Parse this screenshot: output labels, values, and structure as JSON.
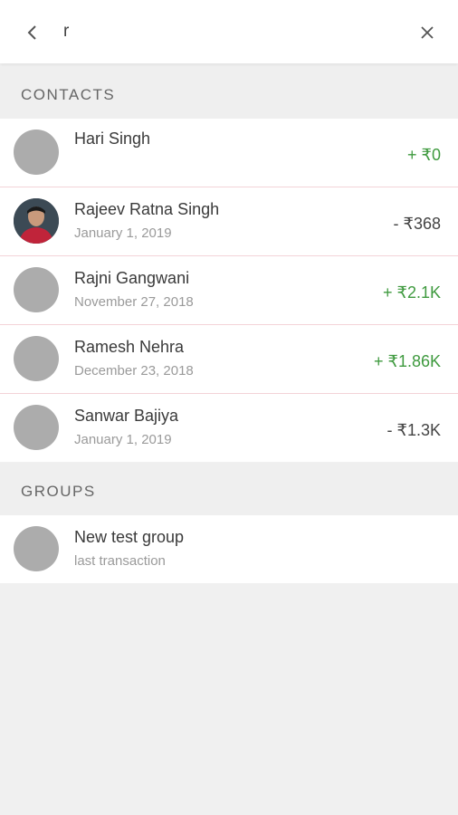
{
  "search": {
    "value": "r"
  },
  "sections": {
    "contacts_title": "CONTACTS",
    "groups_title": "GROUPS"
  },
  "contacts": [
    {
      "name": "Hari Singh",
      "date": "",
      "amount": "+ ₹0",
      "sign": "positive",
      "has_photo": false
    },
    {
      "name": "Rajeev Ratna Singh",
      "date": "January 1, 2019",
      "amount": "- ₹368",
      "sign": "negative",
      "has_photo": true
    },
    {
      "name": "Rajni Gangwani",
      "date": "November 27, 2018",
      "amount": "+ ₹2.1K",
      "sign": "positive",
      "has_photo": false
    },
    {
      "name": "Ramesh Nehra",
      "date": "December 23, 2018",
      "amount": "+ ₹1.86K",
      "sign": "positive",
      "has_photo": false
    },
    {
      "name": "Sanwar Bajiya",
      "date": "January 1, 2019",
      "amount": "- ₹1.3K",
      "sign": "negative",
      "has_photo": false
    }
  ],
  "groups": [
    {
      "name": "New test group",
      "sub": "last transaction"
    }
  ],
  "colors": {
    "positive": "#3f9a3f",
    "negative": "#444444",
    "divider": "#f3d3d8",
    "avatar_placeholder": "#acacac"
  },
  "icons": {
    "back": "chevron-left-icon",
    "close": "close-icon"
  }
}
